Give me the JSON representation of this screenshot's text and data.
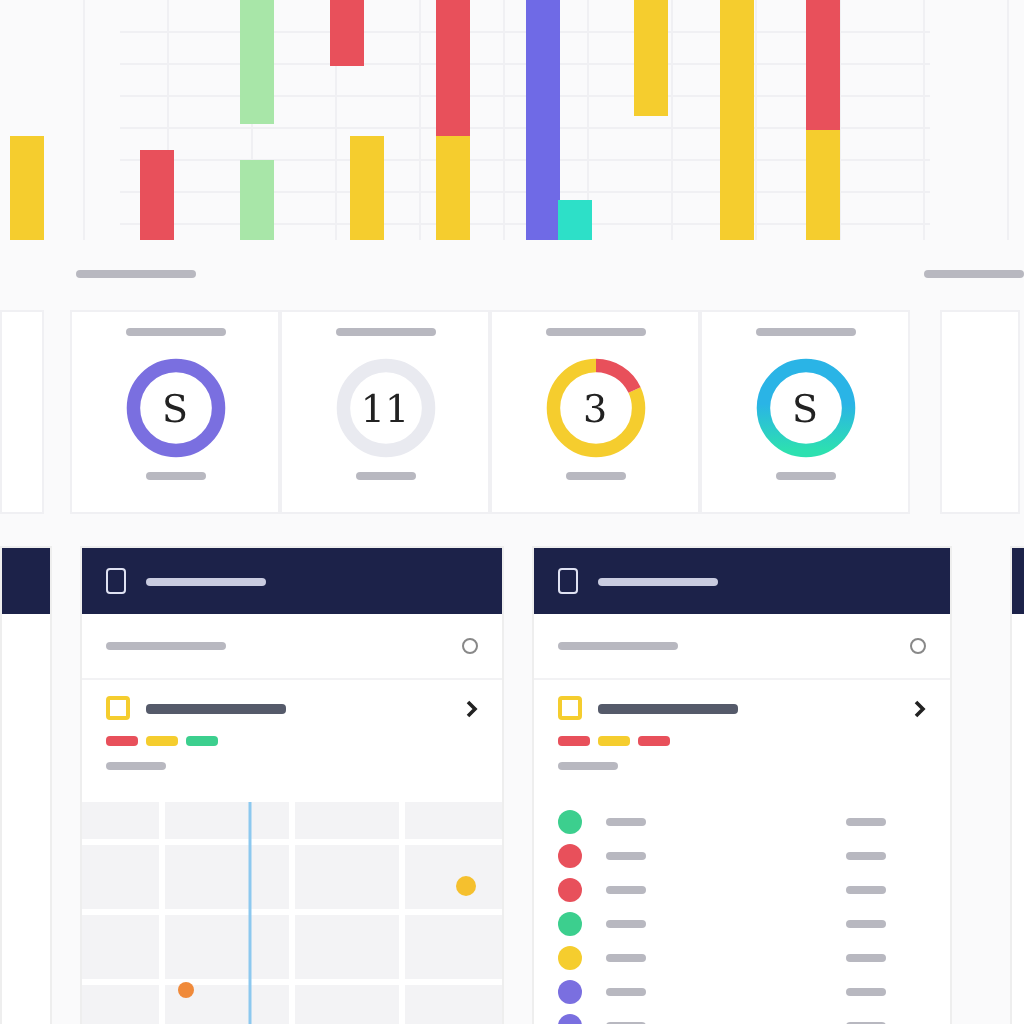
{
  "donuts": [
    {
      "value": "S",
      "kind": "ring",
      "color": "#7a6fe0"
    },
    {
      "value": "11",
      "kind": "empty",
      "color": "#e9eaf0"
    },
    {
      "value": "3",
      "kind": "split",
      "color": "#f5cd2e"
    },
    {
      "value": "S",
      "kind": "gradient",
      "color": "#2ab4e6"
    }
  ],
  "panels": [
    {
      "kind": "map",
      "tags": [
        {
          "color": "#e8505b"
        },
        {
          "color": "#f5cd2e"
        },
        {
          "color": "#3ccf8e"
        }
      ]
    },
    {
      "kind": "list",
      "tags": [
        {
          "color": "#e8505b"
        },
        {
          "color": "#f5cd2e"
        },
        {
          "color": "#e8505b"
        }
      ],
      "items": [
        {
          "color": "#3ccf8e"
        },
        {
          "color": "#e8505b"
        },
        {
          "color": "#e8505b"
        },
        {
          "color": "#3ccf8e"
        },
        {
          "color": "#f5cd2e"
        },
        {
          "color": "#7a6fe0"
        },
        {
          "color": "#7a6fe0"
        }
      ]
    }
  ]
}
